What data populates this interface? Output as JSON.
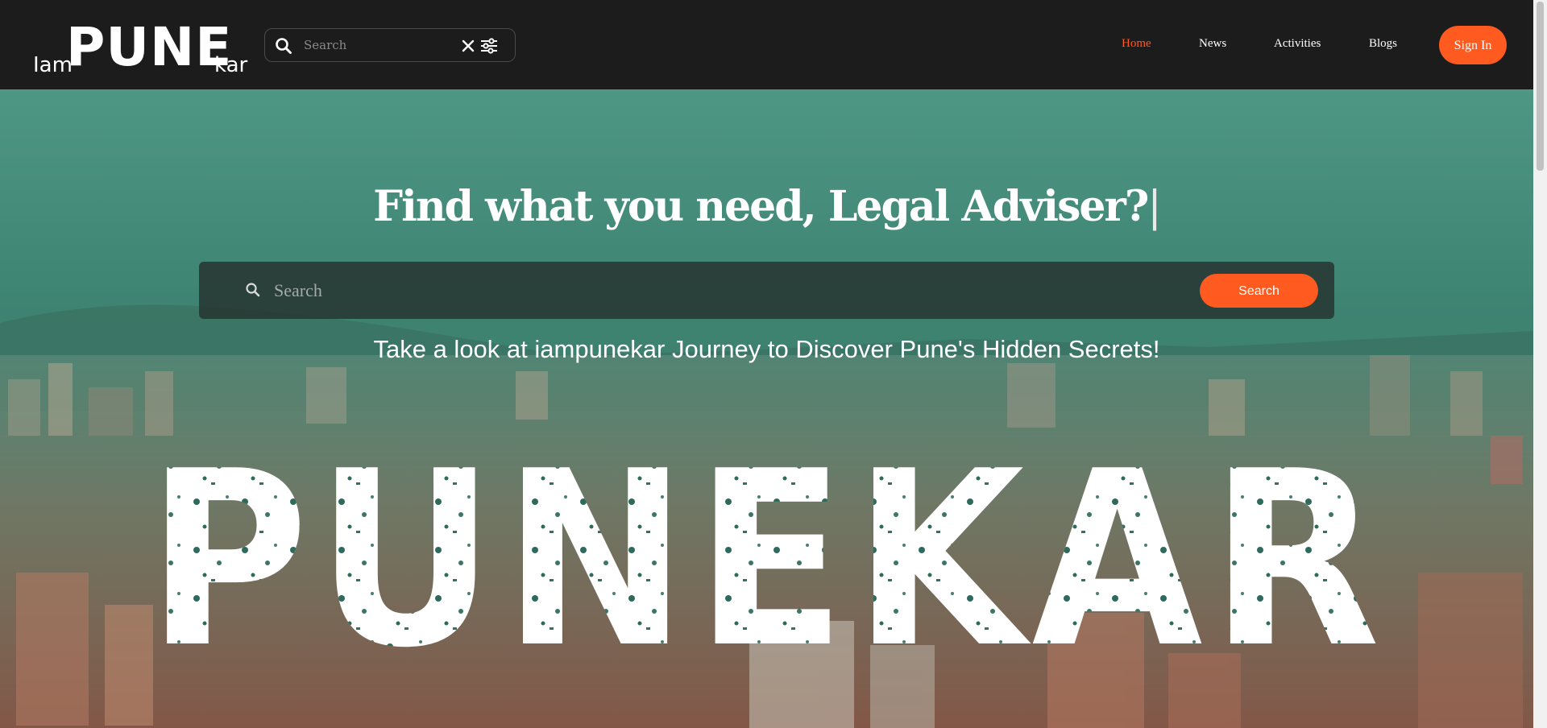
{
  "logo": {
    "iam": "Iam",
    "pune": "PUNE",
    "kar": "kar"
  },
  "nav_search": {
    "placeholder": "Search"
  },
  "nav": {
    "items": [
      {
        "label": "Home",
        "active": true
      },
      {
        "label": "News",
        "active": false
      },
      {
        "label": "Activities",
        "active": false
      },
      {
        "label": "Blogs",
        "active": false
      }
    ],
    "signin_label": "Sign In"
  },
  "hero": {
    "title": "Find what you need, Legal Adviser?",
    "caret": "|",
    "search_placeholder": "Search",
    "search_button": "Search",
    "tagline": "Take a look at iampunekar Journey to Discover Pune's Hidden Secrets!",
    "big_word": "PUNEKAR"
  },
  "colors": {
    "accent": "#ff5a1f",
    "navbar_bg": "#1c1c1c",
    "text": "#ffffff"
  },
  "icons": [
    "search-icon",
    "clear-icon",
    "filter-icon",
    "search-icon"
  ]
}
